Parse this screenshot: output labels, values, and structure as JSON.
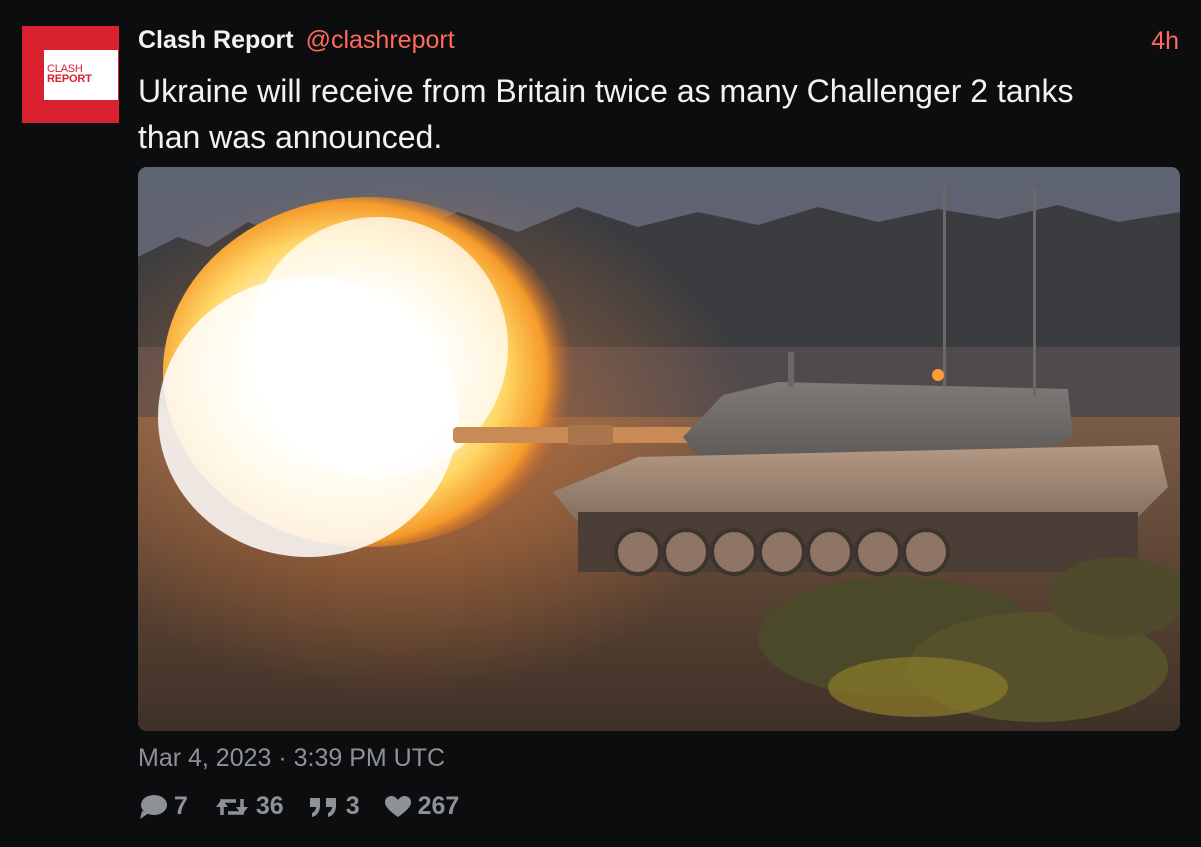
{
  "author": {
    "display_name": "Clash Report",
    "handle": "@clashreport",
    "avatar_text_line1": "CLASH",
    "avatar_text_line2": "REPORT"
  },
  "time_ago": "4h",
  "text": "Ukraine will receive from Britain twice as many Challenger 2 tanks than was announced.",
  "timestamp": "Mar 4, 2023 · 3:39 PM UTC",
  "stats": {
    "comments": "7",
    "retweets": "36",
    "quotes": "3",
    "likes": "267"
  },
  "media": {
    "icon": "tank-firing-photo"
  },
  "colors": {
    "background": "#0c0d0f",
    "accent": "#ff6a5a",
    "muted": "#8e9196",
    "avatar_red": "#d8202f"
  }
}
